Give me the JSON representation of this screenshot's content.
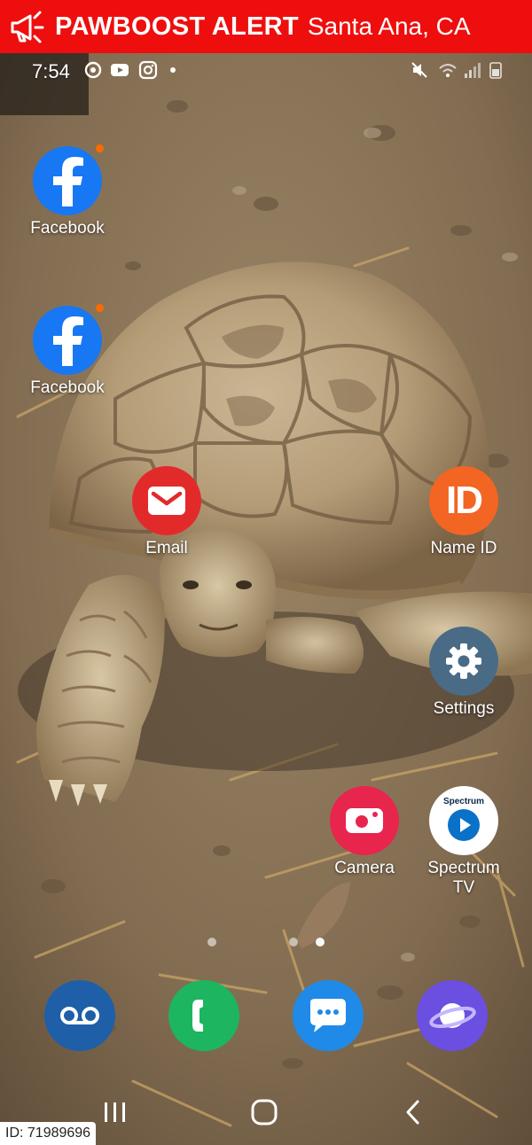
{
  "banner": {
    "brand": "PAWBOOST ALERT",
    "city": "Santa Ana, CA",
    "bg_color": "#ee0e0e",
    "icon": "megaphone-icon"
  },
  "status": {
    "time": "7:54"
  },
  "apps": {
    "facebook1": {
      "label": "Facebook",
      "color": "#1877f2"
    },
    "facebook2": {
      "label": "Facebook",
      "color": "#1877f2"
    },
    "email": {
      "label": "Email",
      "color": "#e32a2a"
    },
    "nameid": {
      "label": "Name ID",
      "color": "#f26522"
    },
    "settings": {
      "label": "Settings",
      "color": "#4a6b86"
    },
    "camera": {
      "label": "Camera",
      "color": "#e8254d"
    },
    "spectrum": {
      "label": "Spectrum\nTV",
      "color": "#ffffff",
      "logo_text": "Spectrum"
    }
  },
  "dock": [
    {
      "name": "voicemail",
      "color": "#1e5fa8",
      "icon": "voicemail-icon"
    },
    {
      "name": "phone",
      "color": "#1db55f",
      "icon": "phone-icon"
    },
    {
      "name": "messages",
      "color": "#1f8ae8",
      "icon": "message-icon"
    },
    {
      "name": "internet",
      "color": "#6a4fe0",
      "icon": "planet-icon"
    }
  ],
  "footer": {
    "id_text": "ID: 71989696"
  }
}
